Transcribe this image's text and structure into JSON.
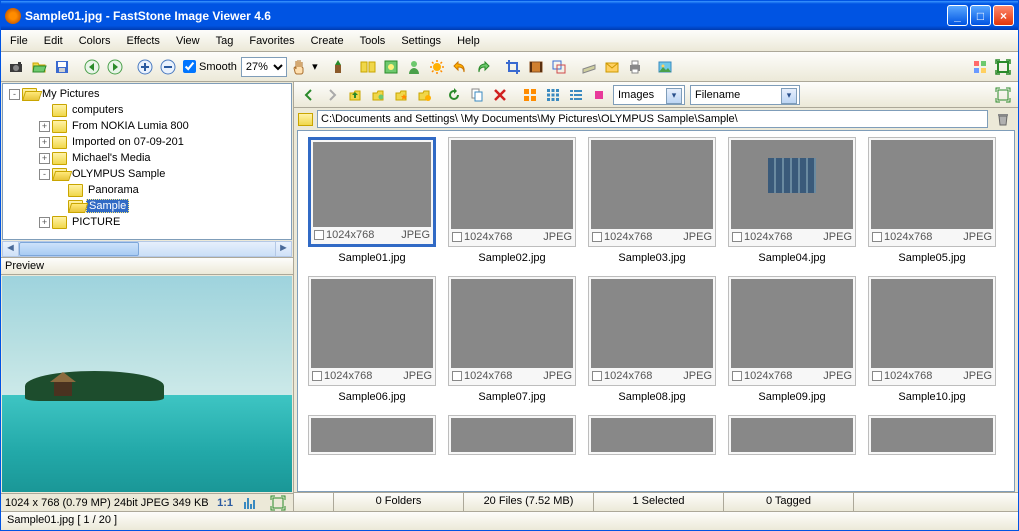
{
  "window": {
    "title": "Sample01.jpg  -  FastStone Image Viewer 4.6"
  },
  "menu": {
    "items": [
      "File",
      "Edit",
      "Colors",
      "Effects",
      "View",
      "Tag",
      "Favorites",
      "Create",
      "Tools",
      "Settings",
      "Help"
    ]
  },
  "toolbar": {
    "smooth_label": "Smooth",
    "zoom": "27%"
  },
  "tree": {
    "root": "My Pictures",
    "items": [
      {
        "label": "computers",
        "depth": 1,
        "exp": ""
      },
      {
        "label": "From NOKIA Lumia 800",
        "depth": 1,
        "exp": "+"
      },
      {
        "label": "Imported on 07-09-201",
        "depth": 1,
        "exp": "+"
      },
      {
        "label": "Michael's Media",
        "depth": 1,
        "exp": "+"
      },
      {
        "label": "OLYMPUS Sample",
        "depth": 1,
        "exp": "-",
        "open": true
      },
      {
        "label": "Panorama",
        "depth": 2,
        "exp": ""
      },
      {
        "label": "Sample",
        "depth": 2,
        "exp": "",
        "sel": true,
        "open": true
      },
      {
        "label": "PICTURE",
        "depth": 1,
        "exp": "+"
      }
    ]
  },
  "preview": {
    "header": "Preview",
    "info": "1024 x 768 (0.79 MP)  24bit  JPEG  349 KB",
    "ratio": "1:1"
  },
  "browser": {
    "filter1": "Images",
    "filter2": "Filename",
    "path": "C:\\Documents and Settings\\            \\My Documents\\My Pictures\\OLYMPUS Sample\\Sample\\",
    "thumbs": [
      {
        "name": "Sample01.jpg",
        "dim": "1024x768",
        "fmt": "JPEG",
        "sel": true,
        "cls": "i-beach"
      },
      {
        "name": "Sample02.jpg",
        "dim": "1024x768",
        "fmt": "JPEG",
        "cls": "i-sunset"
      },
      {
        "name": "Sample03.jpg",
        "dim": "1024x768",
        "fmt": "JPEG",
        "cls": "i-flower-red"
      },
      {
        "name": "Sample04.jpg",
        "dim": "1024x768",
        "fmt": "JPEG",
        "cls": "i-city"
      },
      {
        "name": "Sample05.jpg",
        "dim": "1024x768",
        "fmt": "JPEG",
        "cls": "i-ball"
      },
      {
        "name": "Sample06.jpg",
        "dim": "1024x768",
        "fmt": "JPEG",
        "cls": "i-yellow"
      },
      {
        "name": "Sample07.jpg",
        "dim": "1024x768",
        "fmt": "JPEG",
        "cls": "i-field"
      },
      {
        "name": "Sample08.jpg",
        "dim": "1024x768",
        "fmt": "JPEG",
        "cls": "i-hibiscus"
      },
      {
        "name": "Sample09.jpg",
        "dim": "1024x768",
        "fmt": "JPEG",
        "cls": "i-ocean"
      },
      {
        "name": "Sample10.jpg",
        "dim": "1024x768",
        "fmt": "JPEG",
        "cls": "i-waterfall"
      },
      {
        "name": "",
        "dim": "",
        "fmt": "",
        "cls": "i-partial"
      },
      {
        "name": "",
        "dim": "",
        "fmt": "",
        "cls": "i-partial"
      },
      {
        "name": "",
        "dim": "",
        "fmt": "",
        "cls": "i-partial"
      },
      {
        "name": "",
        "dim": "",
        "fmt": "",
        "cls": "i-partial"
      },
      {
        "name": "",
        "dim": "",
        "fmt": "",
        "cls": "i-partial"
      }
    ],
    "status": {
      "folders": "0 Folders",
      "files": "20 Files (7.52 MB)",
      "selected": "1 Selected",
      "tagged": "0 Tagged"
    }
  },
  "status": {
    "text": "Sample01.jpg [ 1 / 20 ]"
  }
}
